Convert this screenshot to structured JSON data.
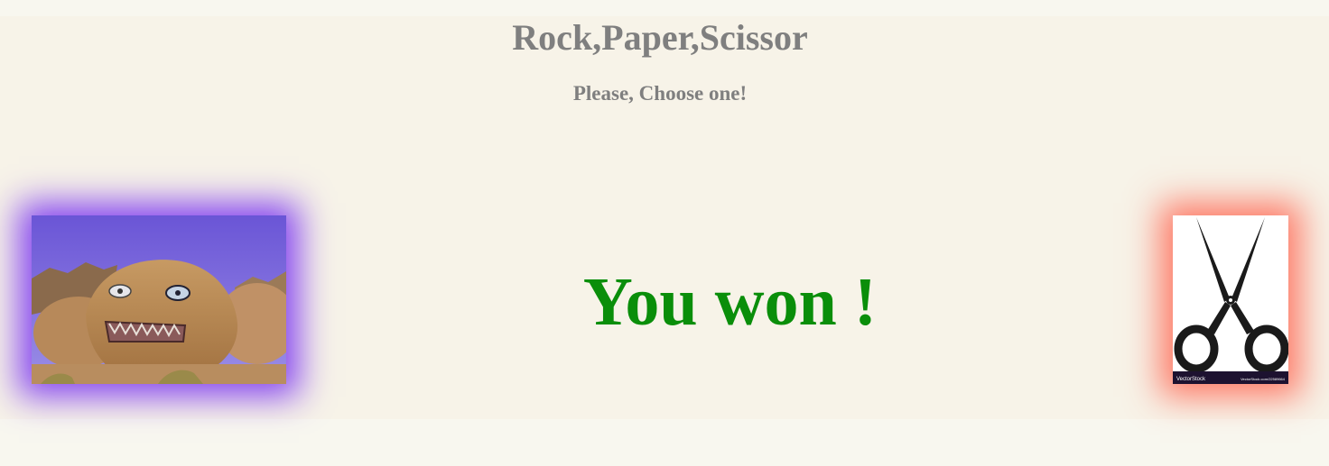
{
  "header": {
    "title": "Rock,Paper,Scissor",
    "subtitle": "Please, Choose one!"
  },
  "result": {
    "text": "You won !",
    "color": "#0a8e0a"
  },
  "choices": {
    "player": {
      "name": "rock",
      "glow_color": "#8040f0"
    },
    "computer": {
      "name": "scissor",
      "glow_color": "#ff6450",
      "watermark_left": "VectorStock",
      "watermark_right": "VectorStock.com/22589664"
    }
  }
}
